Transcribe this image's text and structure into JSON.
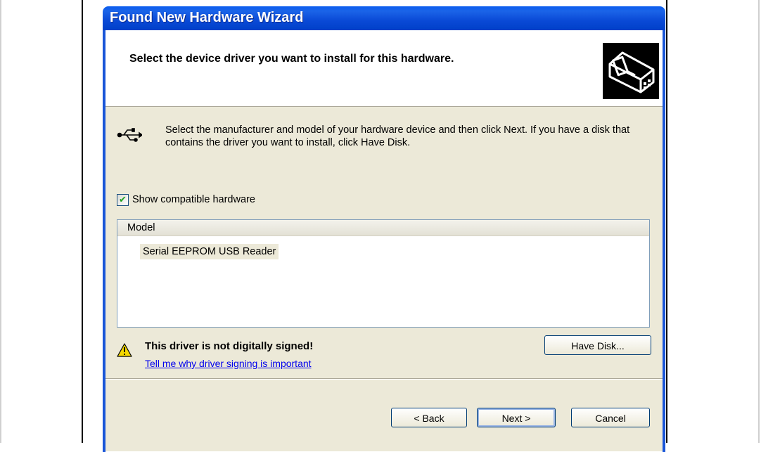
{
  "window": {
    "title": "Found New Hardware Wizard"
  },
  "header": {
    "title": "Select the device driver you want to install for this hardware.",
    "icon": "hardware-install-icon"
  },
  "intro": {
    "text": "Select the manufacturer and model of your hardware device and then click Next. If you have a disk that contains the driver you want to install, click Have Disk.",
    "icon": "usb-icon"
  },
  "options": {
    "show_compatible_label": "Show compatible hardware",
    "show_compatible_checked": true
  },
  "model_list": {
    "column_header": "Model",
    "items": [
      "Serial EEPROM USB Reader"
    ],
    "selected_index": 0
  },
  "warning": {
    "icon": "warning-icon",
    "text": "This driver is not digitally signed!",
    "link": "Tell me why driver signing is important"
  },
  "buttons": {
    "have_disk": "Have Disk...",
    "back": "< Back",
    "next": "Next >",
    "cancel": "Cancel"
  },
  "colors": {
    "titlebar": "#0a49d6",
    "dialog_body": "#ece9d8",
    "link": "#0000ee"
  }
}
